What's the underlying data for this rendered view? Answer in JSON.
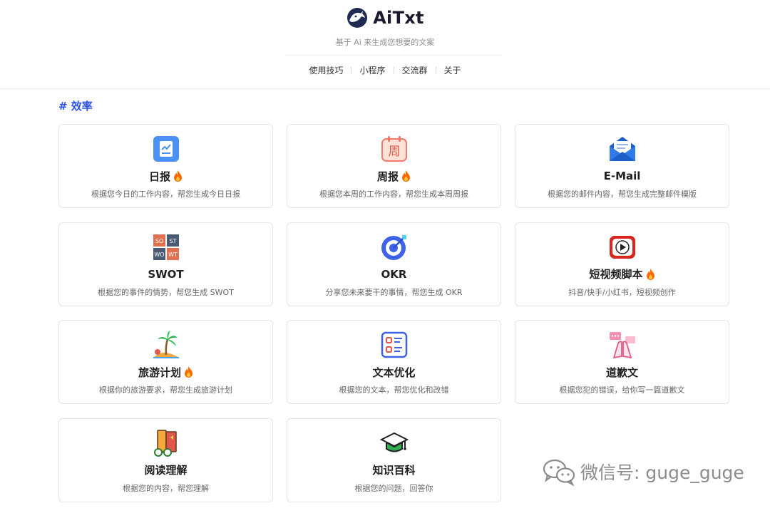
{
  "header": {
    "brand_name": "AiTxt",
    "slogan": "基于 Ai 来生成您想要的文案",
    "nav": [
      "使用技巧",
      "小程序",
      "交流群",
      "关于"
    ]
  },
  "section": {
    "title": "# 效率"
  },
  "cards": [
    {
      "title": "日报",
      "hot": true,
      "desc": "根据您今日的工作内容，帮您生成今日日报",
      "icon": "daily-report-icon"
    },
    {
      "title": "周报",
      "hot": true,
      "desc": "根据您本周的工作内容，帮您生成本周周报",
      "icon": "weekly-calendar-icon"
    },
    {
      "title": "E-Mail",
      "hot": false,
      "desc": "根据您的邮件内容，帮您生成完整邮件模版",
      "icon": "envelope-icon"
    },
    {
      "title": "SWOT",
      "hot": false,
      "desc": "根据您的事件的情势，帮您生成 SWOT",
      "icon": "swot-grid-icon",
      "swot_labels": [
        "SO",
        "ST",
        "WO",
        "WT"
      ]
    },
    {
      "title": "OKR",
      "hot": false,
      "desc": "分享您未来要干的事情，帮您生成 OKR",
      "icon": "target-icon"
    },
    {
      "title": "短视频脚本",
      "hot": true,
      "desc": "抖音/快手/小红书，短视频创作",
      "icon": "video-play-icon"
    },
    {
      "title": "旅游计划",
      "hot": true,
      "desc": "根据你的旅游要求，帮您生成旅游计划",
      "icon": "palm-island-icon"
    },
    {
      "title": "文本优化",
      "hot": false,
      "desc": "根据您的文本，帮您优化和改错",
      "icon": "text-list-icon"
    },
    {
      "title": "道歉文",
      "hot": false,
      "desc": "根据您犯的错误，给你写一篇道歉文",
      "icon": "apology-hands-icon"
    },
    {
      "title": "阅读理解",
      "hot": false,
      "desc": "根据您的内容，帮您理解",
      "icon": "reading-books-icon"
    },
    {
      "title": "知识百科",
      "hot": false,
      "desc": "根据您的问题，回答你",
      "icon": "graduation-cap-icon"
    }
  ],
  "watermark": {
    "text": "微信号: guge_guge"
  },
  "colors": {
    "accent": "#2f54eb",
    "fire": "#ff6a00"
  }
}
